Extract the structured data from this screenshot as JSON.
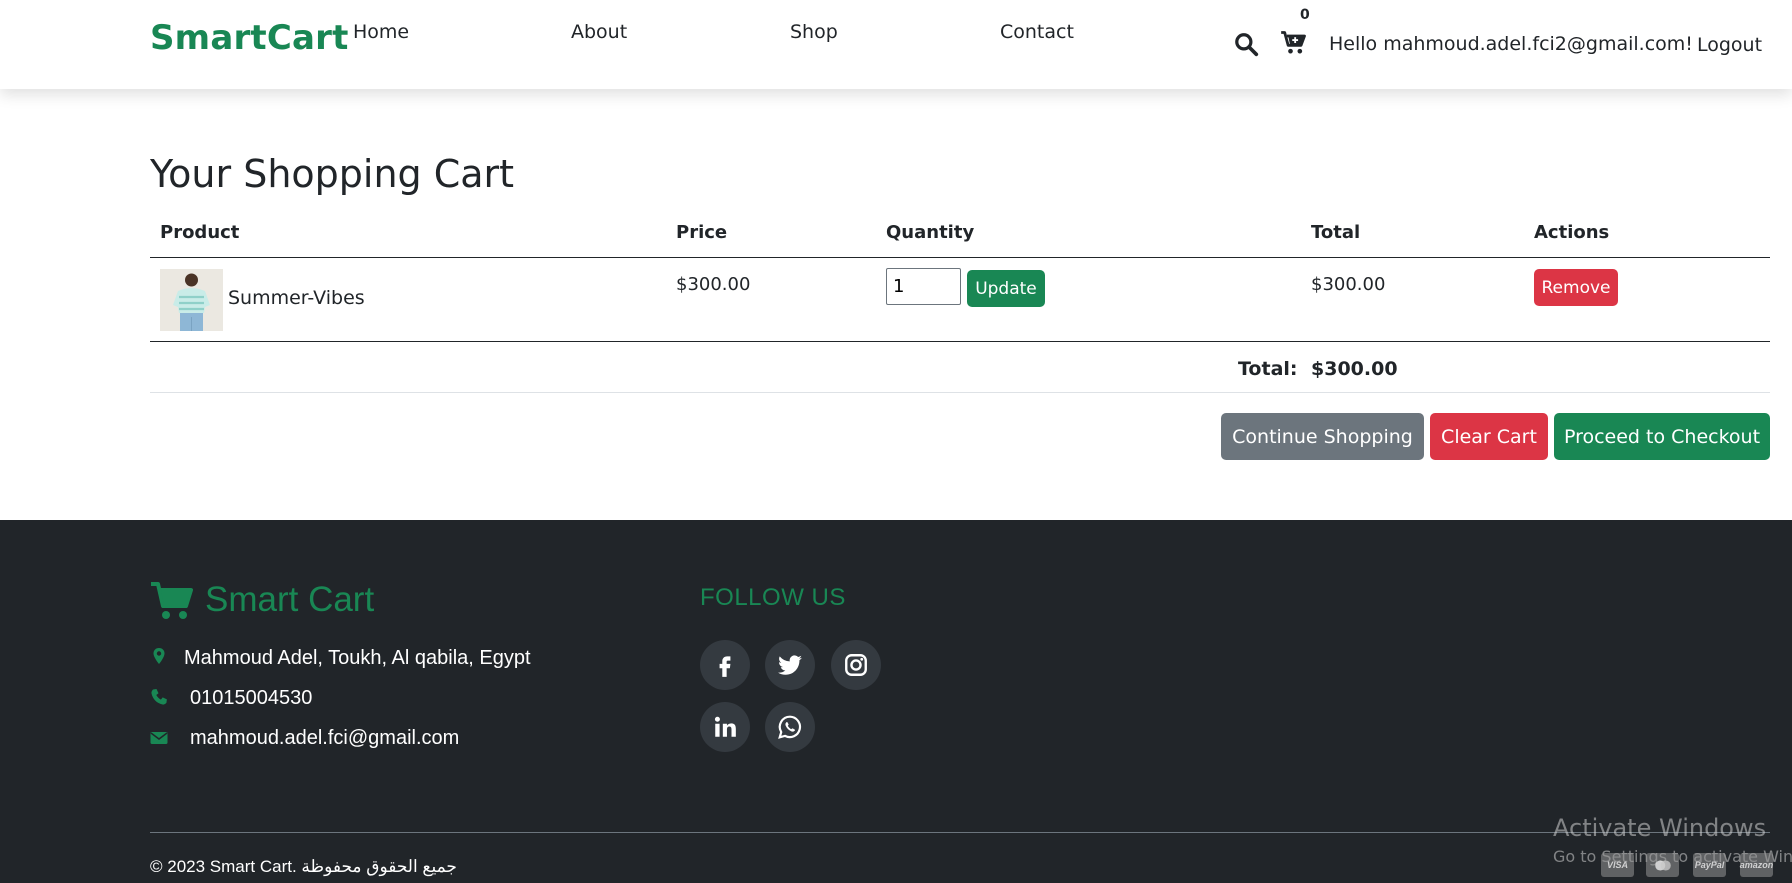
{
  "navbar": {
    "brand": "SmartCart",
    "links": [
      "Home",
      "About",
      "Shop",
      "Contact"
    ],
    "cart_count": "0",
    "greeting": "Hello mahmoud.adel.fci2@gmail.com!",
    "logout": "Logout",
    "icons": [
      "search-icon",
      "cart-icon"
    ]
  },
  "cart": {
    "title": "Your Shopping Cart",
    "headers": [
      "Product",
      "Price",
      "Quantity",
      "Total",
      "Actions"
    ],
    "items": [
      {
        "name": "Summer-Vibes",
        "price": "$300.00",
        "quantity": "1",
        "total": "$300.00",
        "update_label": "Update",
        "remove_label": "Remove"
      }
    ],
    "total_label": "Total:",
    "total_value": "$300.00",
    "buttons": {
      "continue": "Continue Shopping",
      "clear": "Clear Cart",
      "checkout": "Proceed to Checkout"
    }
  },
  "footer": {
    "brand": "Smart Cart",
    "address": "Mahmoud Adel, Toukh, Al qabila, Egypt",
    "phone": "01015004530",
    "email": "mahmoud.adel.fci@gmail.com",
    "follow_title": "FOLLOW US",
    "social": [
      "facebook-icon",
      "twitter-icon",
      "instagram-icon",
      "linkedin-icon",
      "whatsapp-icon"
    ],
    "copyright": "© 2023 Smart Cart. جميع الحقوق محفوظة"
  },
  "watermark": {
    "title": "Activate Windows",
    "subtitle": "Go to Settings to activate Windows."
  },
  "payment_icons": [
    "visa-icon",
    "mastercard-icon",
    "paypal-icon",
    "amazon-icon"
  ],
  "colors": {
    "primary": "#198754",
    "danger": "#dc3545",
    "secondary": "#6c757d",
    "footer_bg": "#212529"
  }
}
